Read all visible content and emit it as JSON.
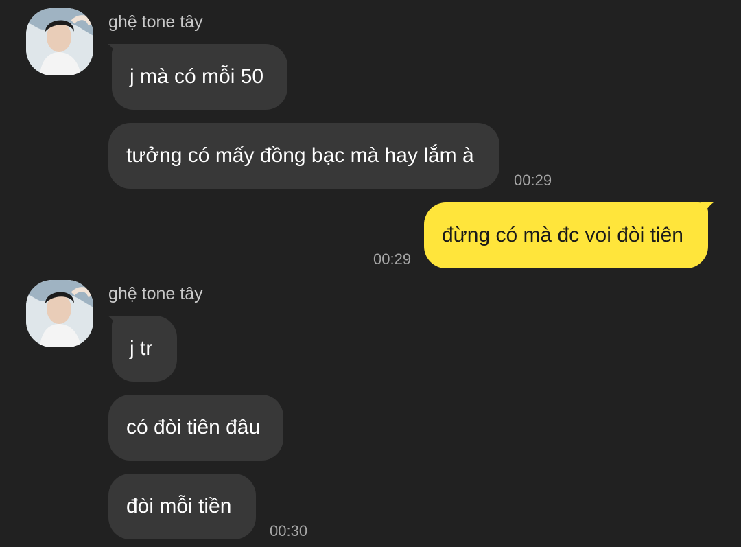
{
  "messages": {
    "group1": {
      "sender": "ghệ tone tây",
      "bubbles": [
        "j mà có mỗi 50",
        "tưởng có mấy đồng bạc mà hay lắm à"
      ],
      "time": "00:29"
    },
    "outgoing": {
      "text": "đừng có mà đc voi đòi tiên",
      "time": "00:29"
    },
    "group2": {
      "sender": "ghệ tone tây",
      "bubbles": [
        "j tr",
        "có đòi tiên đâu",
        "đòi mỗi tiền"
      ],
      "time": "00:30"
    }
  },
  "colors": {
    "background": "#212121",
    "incoming_bubble": "#383838",
    "outgoing_bubble": "#ffe53b",
    "timestamp": "#a6a6a6"
  },
  "icons": {
    "avatar": "profile-photo"
  }
}
